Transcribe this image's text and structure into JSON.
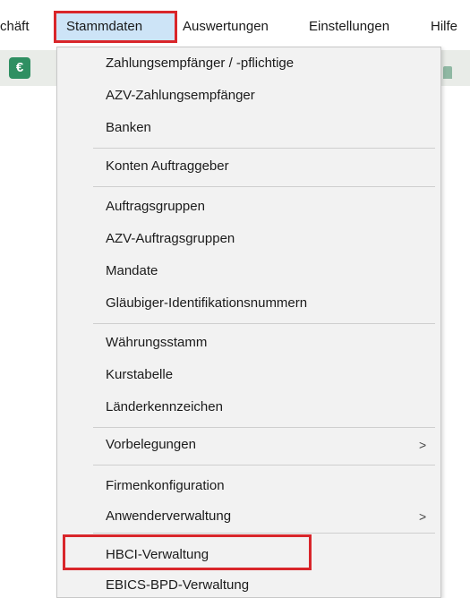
{
  "menubar": {
    "items": [
      "chäft",
      "Stammdaten",
      "Auswertungen",
      "Einstellungen",
      "Hilfe"
    ],
    "active": "Stammdaten"
  },
  "toolbar": {
    "icon": "euro-icon",
    "euro_glyph": "€",
    "accent": "#2f8f62"
  },
  "dropdown": {
    "items": [
      {
        "label": "Zahlungsempfänger / -pflichtige"
      },
      {
        "label": "AZV-Zahlungsempfänger"
      },
      {
        "label": "Banken"
      },
      {
        "label": "Konten Auftraggeber"
      },
      {
        "label": "Auftragsgruppen"
      },
      {
        "label": "AZV-Auftragsgruppen"
      },
      {
        "label": "Mandate"
      },
      {
        "label": "Gläubiger-Identifikationsnummern"
      },
      {
        "label": "Währungsstamm"
      },
      {
        "label": "Kurstabelle"
      },
      {
        "label": "Länderkennzeichen"
      },
      {
        "label": "Vorbelegungen",
        "submenu": ">"
      },
      {
        "label": "Firmenkonfiguration"
      },
      {
        "label": "Anwenderverwaltung",
        "submenu": ">"
      },
      {
        "label": "HBCI-Verwaltung"
      },
      {
        "label": "EBICS-BPD-Verwaltung"
      }
    ]
  },
  "highlight_color": "#d9262b"
}
